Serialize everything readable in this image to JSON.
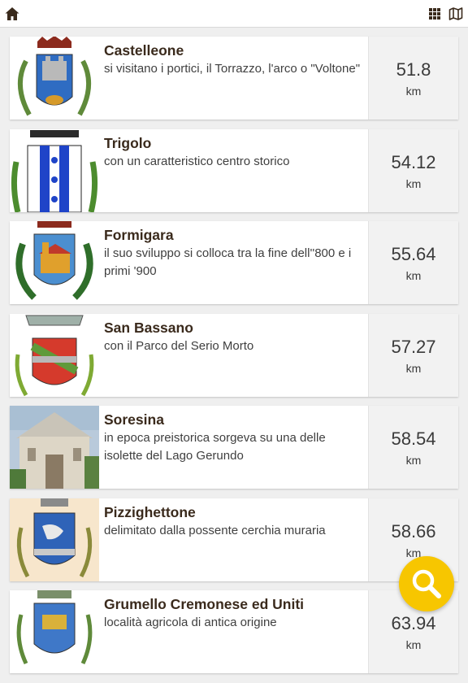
{
  "toolbar": {
    "home_icon": "home-icon",
    "grid_icon": "grid-view-icon",
    "map_icon": "map-icon"
  },
  "places": [
    {
      "name": "Castelleone",
      "description": "si visitano i portici, il Torrazzo, l'arco o \"Voltone\"",
      "distance": "51.8",
      "unit": "km"
    },
    {
      "name": "Trigolo",
      "description": "con un caratteristico centro storico",
      "distance": "54.12",
      "unit": "km"
    },
    {
      "name": "Formigara",
      "description": "il suo sviluppo si colloca tra la fine dell''800 e i primi '900",
      "distance": "55.64",
      "unit": "km"
    },
    {
      "name": "San Bassano",
      "description": "con il Parco del Serio Morto",
      "distance": "57.27",
      "unit": "km"
    },
    {
      "name": "Soresina",
      "description": "in epoca preistorica sorgeva su una delle isolette del Lago Gerundo",
      "distance": "58.54",
      "unit": "km"
    },
    {
      "name": "Pizzighettone",
      "description": "delimitato dalla possente cerchia muraria",
      "distance": "58.66",
      "unit": "km"
    },
    {
      "name": "Grumello Cremonese ed Uniti",
      "description": "località agricola di antica origine",
      "distance": "63.94",
      "unit": "km"
    }
  ],
  "search_fab": {
    "icon": "search-icon",
    "color": "#f7c600"
  }
}
